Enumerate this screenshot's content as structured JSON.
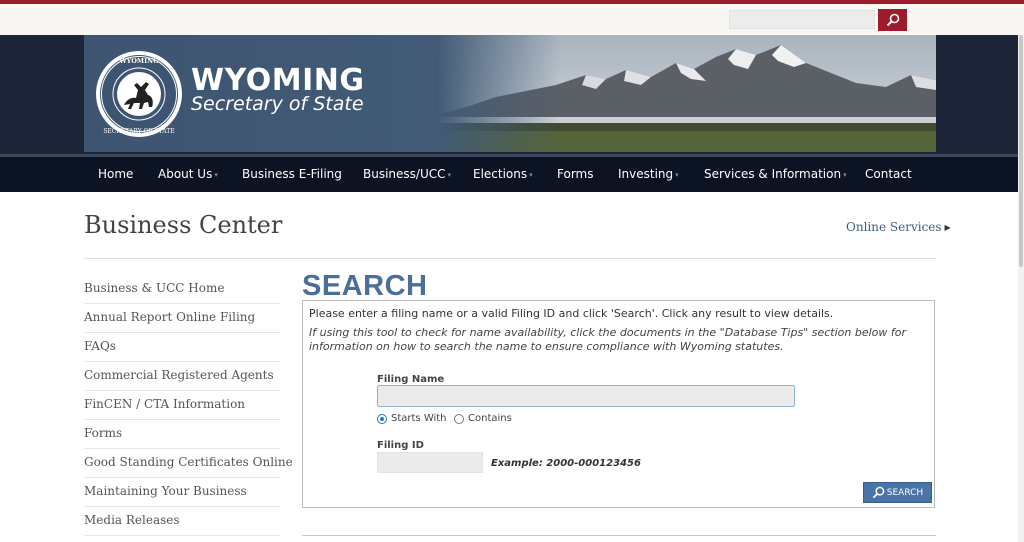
{
  "top_search": {
    "placeholder": "",
    "button_icon": "search-icon"
  },
  "brand": {
    "title": "WYOMING",
    "subtitle": "Secretary of State",
    "seal_text": "SECRETARY OF STATE"
  },
  "nav": [
    {
      "label": "Home",
      "has_menu": false
    },
    {
      "label": "About Us",
      "has_menu": true
    },
    {
      "label": "Business E-Filing",
      "has_menu": false
    },
    {
      "label": "Business/UCC",
      "has_menu": true
    },
    {
      "label": "Elections",
      "has_menu": true
    },
    {
      "label": "Forms",
      "has_menu": false
    },
    {
      "label": "Investing",
      "has_menu": true
    },
    {
      "label": "Services & Information",
      "has_menu": true
    },
    {
      "label": "Contact",
      "has_menu": false
    }
  ],
  "page": {
    "title": "Business Center",
    "online_services": "Online Services"
  },
  "sidebar": [
    {
      "label": "Business & UCC Home"
    },
    {
      "label": "Annual Report Online Filing"
    },
    {
      "label": "FAQs"
    },
    {
      "label": "Commercial Registered Agents"
    },
    {
      "label": "FinCEN / CTA Information"
    },
    {
      "label": "Forms"
    },
    {
      "label": "Good Standing Certificates Online"
    },
    {
      "label": "Maintaining Your Business"
    },
    {
      "label": "Media Releases"
    }
  ],
  "search": {
    "heading": "SEARCH",
    "instruction": "Please enter a filing name or a valid Filing ID and click 'Search'. Click any result to view details.",
    "tip": "If using this tool to check for name availability, click the documents in the \"Database Tips\" section below for information on how to search the name to ensure compliance with Wyoming statutes.",
    "filing_name_label": "Filing Name",
    "filing_name_value": "",
    "radio_starts_with": "Starts With",
    "radio_contains": "Contains",
    "selected_mode": "Starts With",
    "filing_id_label": "Filing ID",
    "filing_id_value": "",
    "example": "Example: 2000-000123456",
    "button": "SEARCH"
  },
  "colors": {
    "brand_red": "#9c1c2c",
    "nav_dark": "#0c1424",
    "link_blue": "#3c5f86",
    "heading_blue": "#4a6f98",
    "button_blue": "#4a73a6"
  }
}
